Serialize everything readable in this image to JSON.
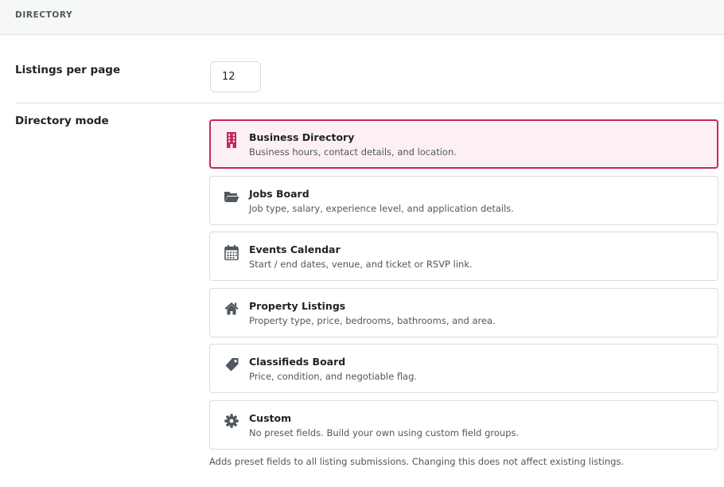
{
  "section": {
    "title": "DIRECTORY"
  },
  "listings_per_page": {
    "label": "Listings per page",
    "value": "12"
  },
  "directory_mode": {
    "label": "Directory mode",
    "selected": "Business Directory",
    "options": [
      {
        "title": "Business Directory",
        "description": "Business hours, contact details, and location.",
        "icon": "building-icon"
      },
      {
        "title": "Jobs Board",
        "description": "Job type, salary, experience level, and application details.",
        "icon": "folder-open-icon"
      },
      {
        "title": "Events Calendar",
        "description": "Start / end dates, venue, and ticket or RSVP link.",
        "icon": "calendar-icon"
      },
      {
        "title": "Property Listings",
        "description": "Property type, price, bedrooms, bathrooms, and area.",
        "icon": "house-icon"
      },
      {
        "title": "Classifieds Board",
        "description": "Price, condition, and negotiable flag.",
        "icon": "tag-icon"
      },
      {
        "title": "Custom",
        "description": "No preset fields. Build your own using custom field groups.",
        "icon": "gear-icon"
      }
    ],
    "help": "Adds preset fields to all listing submissions. Changing this does not affect existing listings."
  },
  "colors": {
    "accent": "#c7275d",
    "selected_bg": "#fdf0f4",
    "icon": "#50575e"
  }
}
